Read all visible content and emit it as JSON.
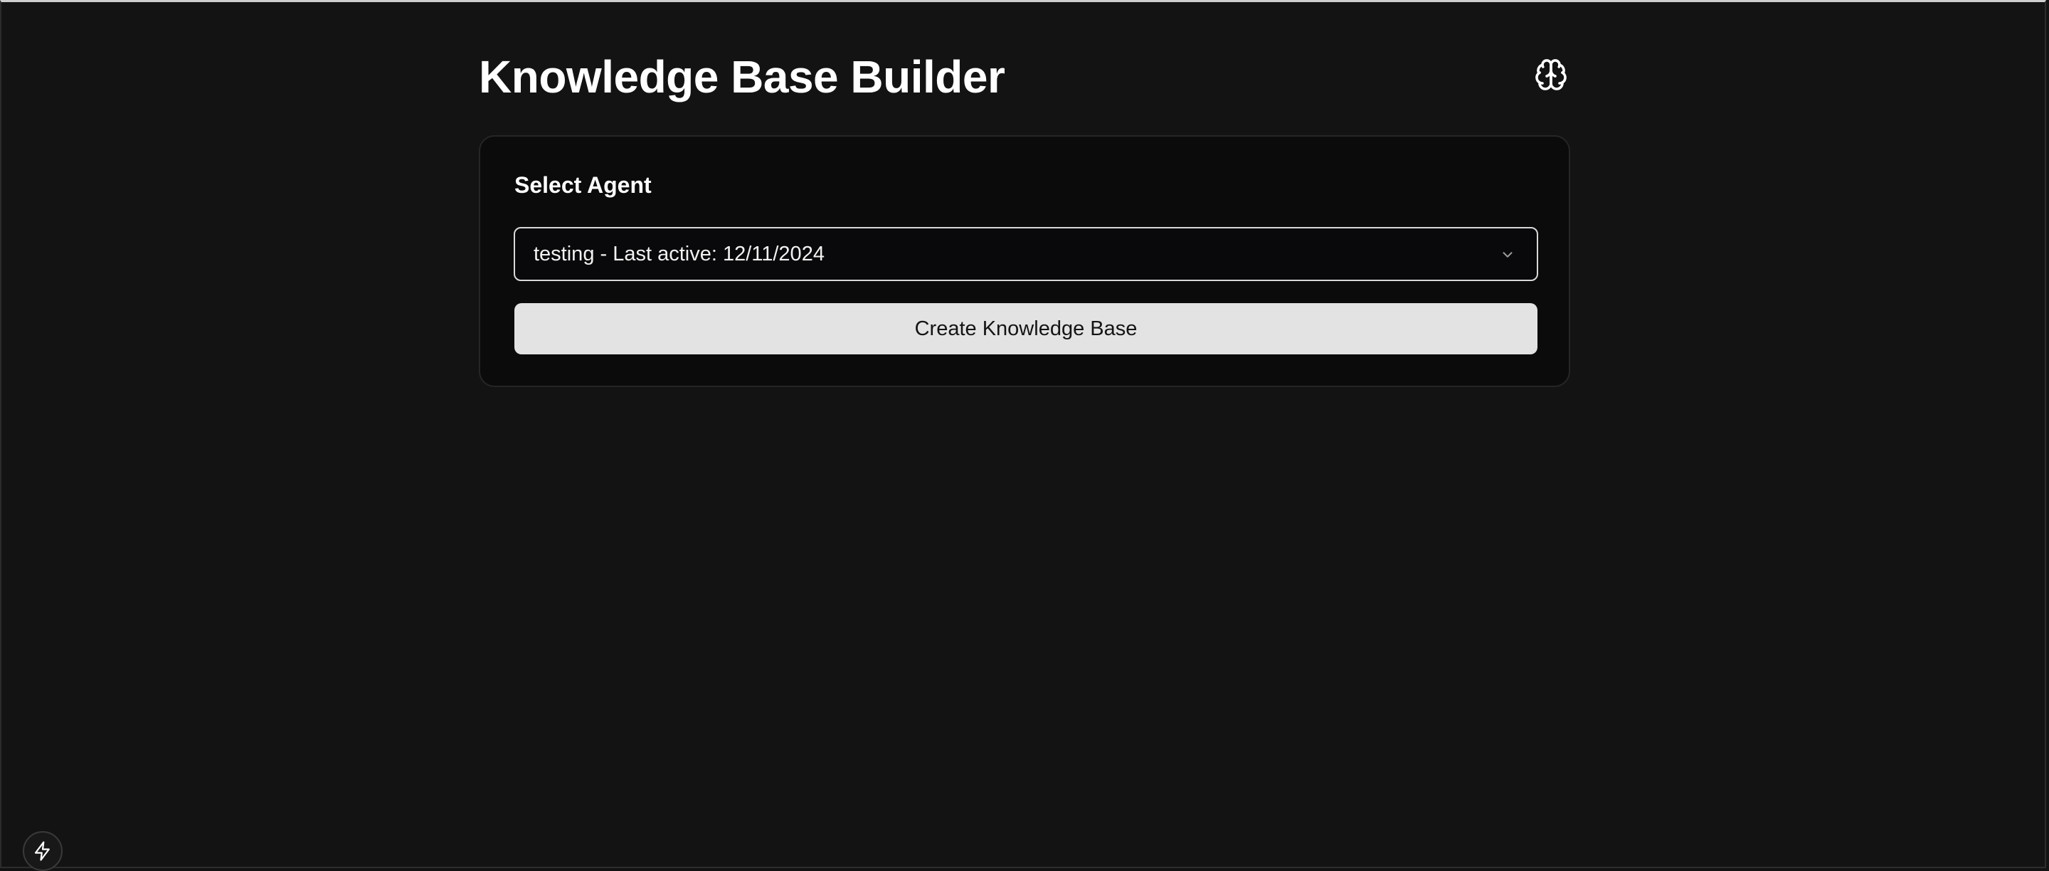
{
  "header": {
    "title": "Knowledge Base Builder",
    "icon": "brain-icon"
  },
  "card": {
    "label": "Select Agent",
    "select": {
      "value": "testing - Last active: 12/11/2024",
      "icon": "chevron-down-icon"
    },
    "create_button_label": "Create Knowledge Base"
  },
  "corner_button": {
    "icon": "lightning-bolt-icon"
  },
  "colors": {
    "background": "#131313",
    "card_background": "#0b0b0c",
    "card_border": "#262626",
    "button_background": "#e3e3e3",
    "text_primary": "#ffffff"
  }
}
